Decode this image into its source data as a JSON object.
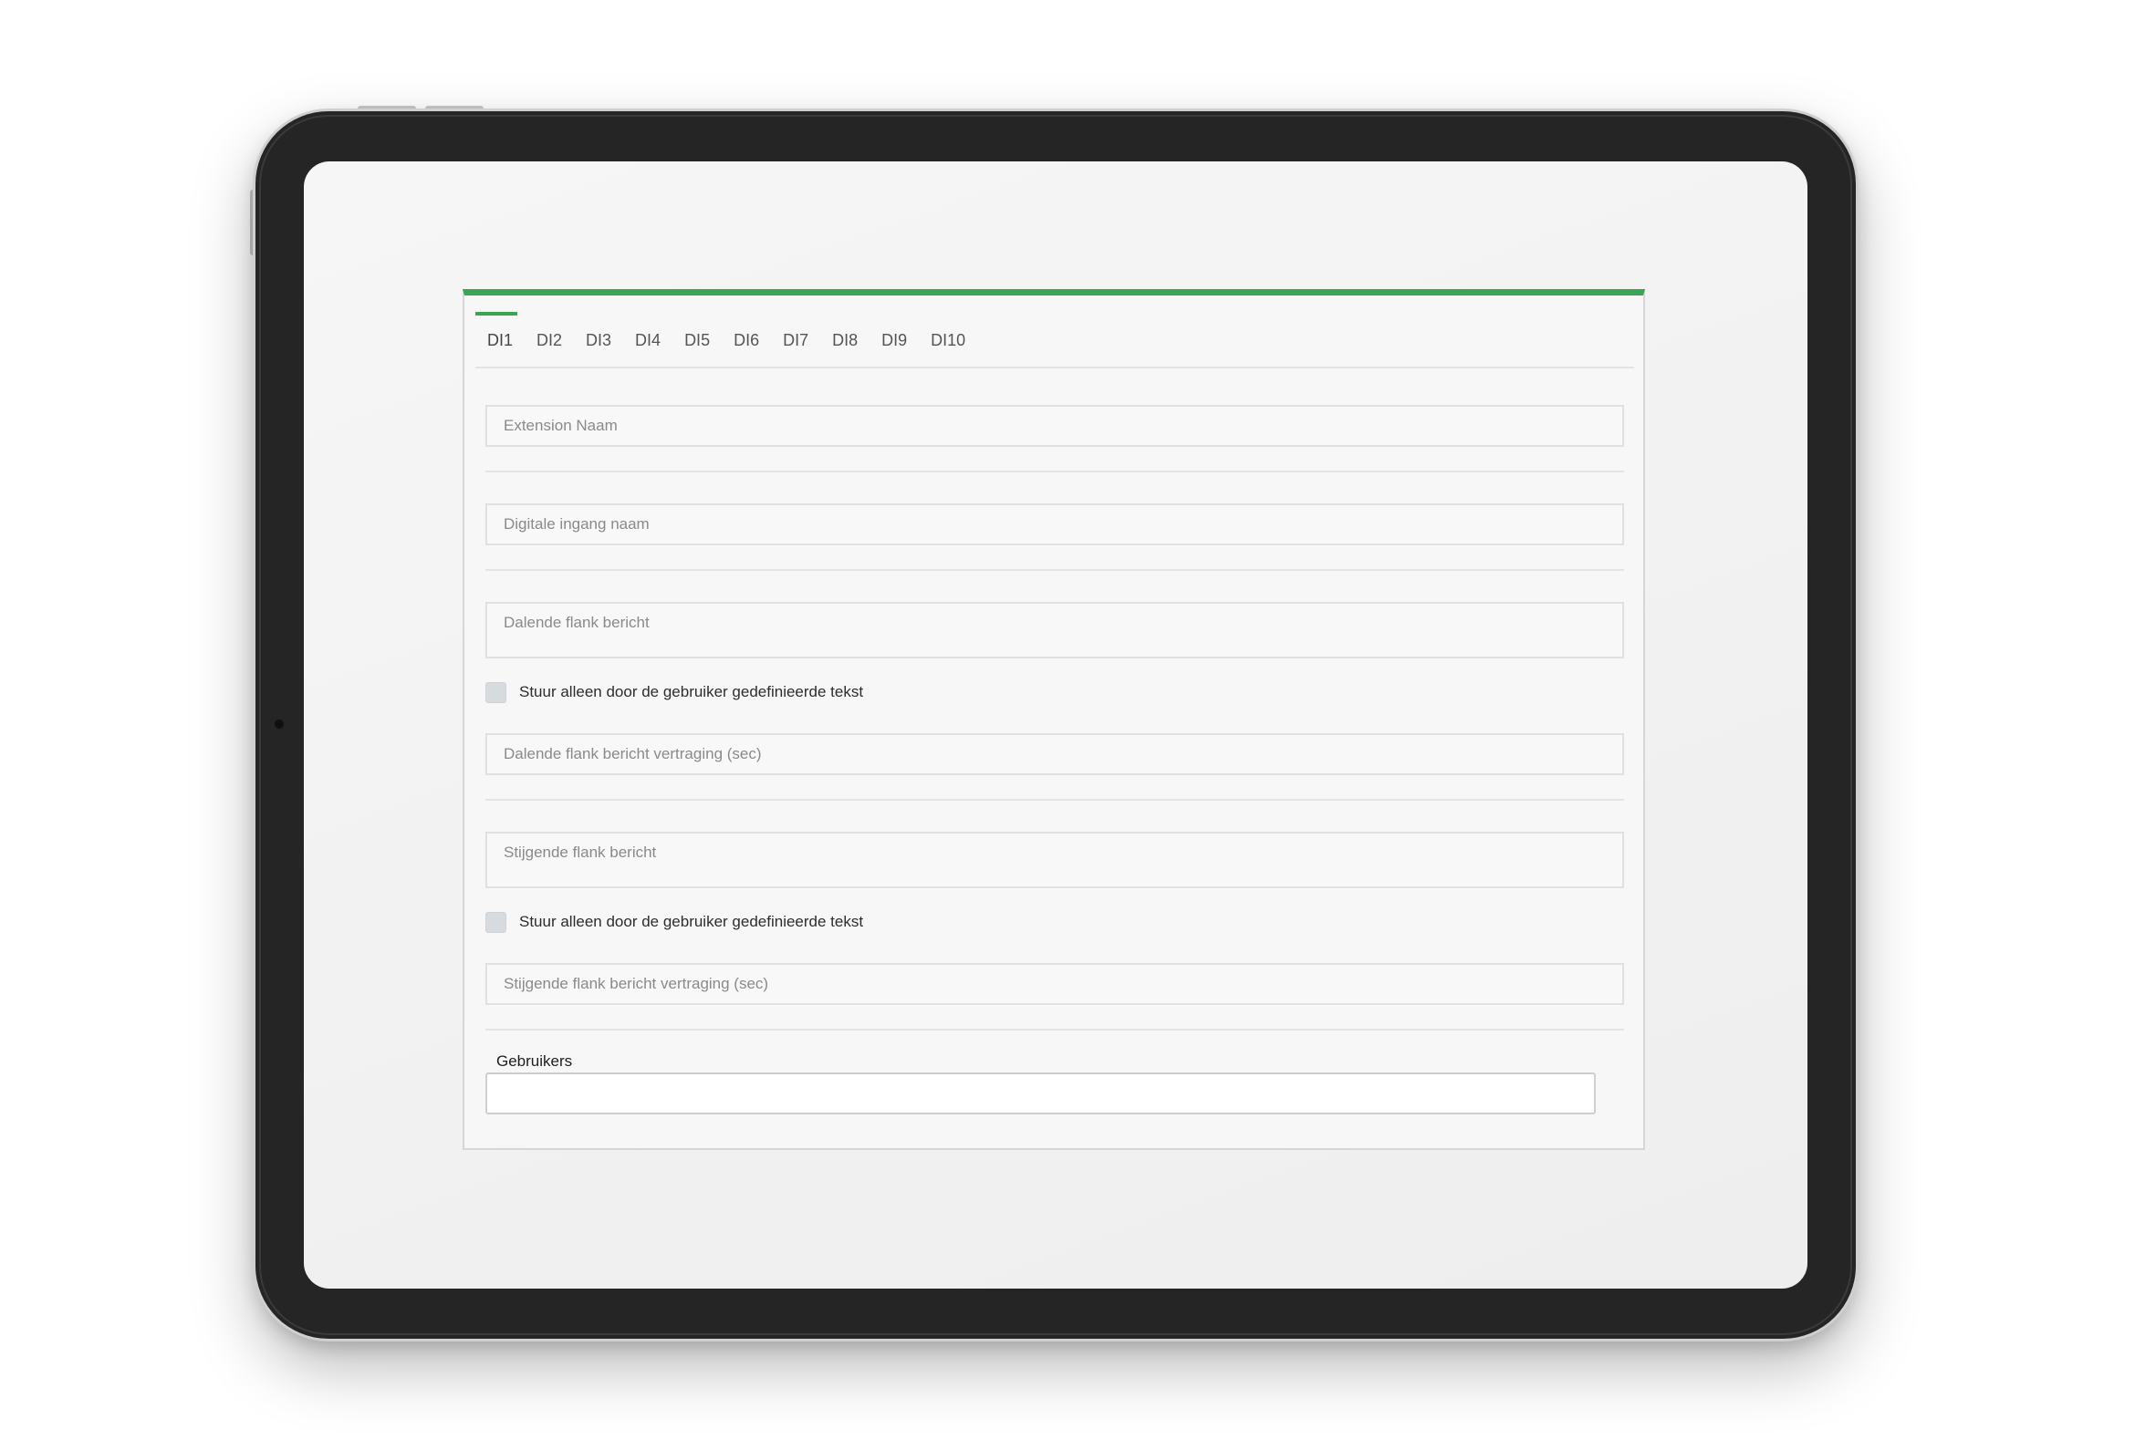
{
  "tabs": [
    {
      "label": "DI1",
      "active": true
    },
    {
      "label": "DI2",
      "active": false
    },
    {
      "label": "DI3",
      "active": false
    },
    {
      "label": "DI4",
      "active": false
    },
    {
      "label": "DI5",
      "active": false
    },
    {
      "label": "DI6",
      "active": false
    },
    {
      "label": "DI7",
      "active": false
    },
    {
      "label": "DI8",
      "active": false
    },
    {
      "label": "DI9",
      "active": false
    },
    {
      "label": "DI10",
      "active": false
    }
  ],
  "form": {
    "extension_name": {
      "placeholder": "Extension Naam",
      "value": ""
    },
    "digital_input_name": {
      "placeholder": "Digitale ingang naam",
      "value": ""
    },
    "falling_edge_message": {
      "placeholder": "Dalende flank bericht",
      "value": ""
    },
    "falling_only_user_text": {
      "label": "Stuur alleen door de gebruiker gedefinieerde tekst",
      "checked": false
    },
    "falling_edge_delay": {
      "placeholder": "Dalende flank bericht vertraging (sec)",
      "value": ""
    },
    "rising_edge_message": {
      "placeholder": "Stijgende flank bericht",
      "value": ""
    },
    "rising_only_user_text": {
      "label": "Stuur alleen door de gebruiker gedefinieerde tekst",
      "checked": false
    },
    "rising_edge_delay": {
      "placeholder": "Stijgende flank bericht vertraging (sec)",
      "value": ""
    },
    "users": {
      "label": "Gebruikers",
      "value": ""
    }
  },
  "colors": {
    "accent": "#3aa655",
    "tablet_frame": "#252525",
    "checkbox": "#d8dbde"
  }
}
